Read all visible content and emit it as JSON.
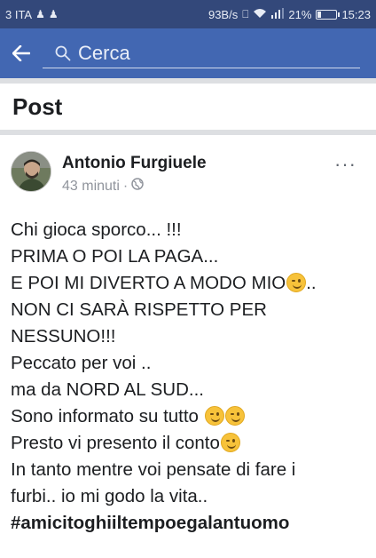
{
  "status_bar": {
    "carrier": "3 ITA",
    "network_speed": "93B/s",
    "battery": "21%",
    "time": "15:23"
  },
  "toolbar": {
    "search_placeholder": "Cerca",
    "back_icon": "arrow-left-icon",
    "search_icon": "magnifier-icon"
  },
  "section": {
    "title": "Post"
  },
  "post": {
    "author": "Antonio Furgiuele",
    "time": "43 minuti",
    "separator": "·",
    "privacy_icon": "globe-icon",
    "more_label": "···",
    "lines": [
      {
        "text": "Chi gioca sporco... !!!",
        "emoji_after": 0
      },
      {
        "text": "PRIMA O POI LA PAGA...",
        "emoji_after": 0
      },
      {
        "text": "E POI MI DIVERTO A MODO MIO",
        "emoji_after": 1,
        "suffix": ".."
      },
      {
        "text": "NON CI SARÀ RISPETTO PER",
        "emoji_after": 0
      },
      {
        "text": "NESSUNO!!!",
        "emoji_after": 0
      },
      {
        "text": "Peccato per voi ..",
        "emoji_after": 0
      },
      {
        "text": "ma da NORD AL SUD...",
        "emoji_after": 0
      },
      {
        "text": "Sono informato su tutto",
        "emoji_after": 2
      },
      {
        "text": "Presto vi presento il conto",
        "emoji_after": 1
      },
      {
        "text": "In tanto mentre voi pensate di fare i",
        "emoji_after": 0
      },
      {
        "text": "furbi.. io mi godo la vita..",
        "emoji_after": 0
      },
      {
        "text": "#amicitoghiiltempoegalantuomo",
        "emoji_after": 0,
        "hashtag": true
      }
    ]
  },
  "colors": {
    "status_bar": "#33487a",
    "toolbar": "#4267b2",
    "divider": "#dddfe2",
    "meta_text": "#90949c"
  }
}
